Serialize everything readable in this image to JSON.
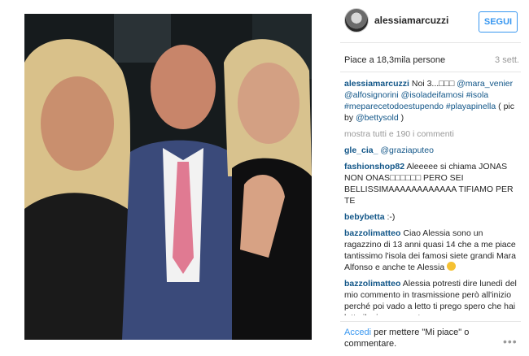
{
  "post": {
    "image_alt_icon": "photo"
  },
  "header": {
    "username": "alessiamarcuzzi",
    "follow_label": "SEGUI"
  },
  "stats": {
    "likes": "Piace a 18,3mila persone",
    "time": "3 sett."
  },
  "caption": {
    "user": "alessiamarcuzzi",
    "text_before": "Noi 3...□□□ ",
    "tags": "@mara_venier @alfosignorini @isoladeifamosi #isola #meparecetodoestupendo #playapinella",
    "text_after": " ( pic by ",
    "credit": "@bettysold",
    "close": " )"
  },
  "more_comments": "mostra tutti e 190 i commenti",
  "comments": [
    {
      "user": "gle_cia_",
      "text": "",
      "tag": "@graziaputeo"
    },
    {
      "user": "fashionshop82",
      "text": "Aleeeee si chiama JONAS NON ONAS□□□□□□ PERO SEI BELLISSIMAAAAAAAAAAAA TIFIAMO PER TE",
      "tag": ""
    },
    {
      "user": "bebybetta",
      "text": ":-)",
      "tag": ""
    },
    {
      "user": "bazzolimatteo",
      "text": "Ciao Alessia sono un ragazzino di 13 anni quasi 14 che a me piace tantissimo l'isola dei famosi siete grandi Mara Alfonso e anche te Alessia",
      "tag": ""
    },
    {
      "user": "bazzolimatteo",
      "text": "Alessia potresti dire lunedì del mio commento in trasmissione però all'inizio perché poi vado a letto ti prego spero che hai letto il mio commento",
      "tag": ""
    }
  ],
  "footer": {
    "login_link": "Accedi",
    "login_text": " per mettere \"Mi piace\" o commentare.",
    "more_icon": "ellipsis-icon"
  },
  "colors": {
    "link": "#125688",
    "accent": "#3897f0",
    "muted": "#999999"
  }
}
